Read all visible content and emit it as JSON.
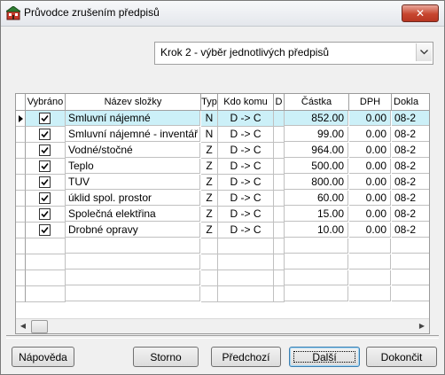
{
  "window": {
    "title": "Průvodce zrušením předpisů",
    "close_glyph": "✕"
  },
  "step_select": {
    "value": "Krok 2 - výběr jednotlivých předpisů"
  },
  "grid": {
    "columns": [
      "Vybráno",
      "Název složky",
      "Typ",
      "Kdo komu",
      "D",
      "Částka",
      "DPH",
      "Dokla"
    ],
    "rows": [
      {
        "checked": true,
        "name": "Smluvní nájemné",
        "typ": "N",
        "kdo_komu": "D -> C",
        "d": "",
        "castka": "852.00",
        "dph": "0.00",
        "doklad": "08-2",
        "selected": true
      },
      {
        "checked": true,
        "name": "Smluvní nájemné - inventář",
        "typ": "N",
        "kdo_komu": "D -> C",
        "d": "",
        "castka": "99.00",
        "dph": "0.00",
        "doklad": "08-2",
        "selected": false
      },
      {
        "checked": true,
        "name": "Vodné/stočné",
        "typ": "Z",
        "kdo_komu": "D -> C",
        "d": "",
        "castka": "964.00",
        "dph": "0.00",
        "doklad": "08-2",
        "selected": false
      },
      {
        "checked": true,
        "name": "Teplo",
        "typ": "Z",
        "kdo_komu": "D -> C",
        "d": "",
        "castka": "500.00",
        "dph": "0.00",
        "doklad": "08-2",
        "selected": false
      },
      {
        "checked": true,
        "name": "TUV",
        "typ": "Z",
        "kdo_komu": "D -> C",
        "d": "",
        "castka": "800.00",
        "dph": "0.00",
        "doklad": "08-2",
        "selected": false
      },
      {
        "checked": true,
        "name": "úklid spol. prostor",
        "typ": "Z",
        "kdo_komu": "D -> C",
        "d": "",
        "castka": "60.00",
        "dph": "0.00",
        "doklad": "08-2",
        "selected": false
      },
      {
        "checked": true,
        "name": "Společná elektřina",
        "typ": "Z",
        "kdo_komu": "D -> C",
        "d": "",
        "castka": "15.00",
        "dph": "0.00",
        "doklad": "08-2",
        "selected": false
      },
      {
        "checked": true,
        "name": "Drobné opravy",
        "typ": "Z",
        "kdo_komu": "D -> C",
        "d": "",
        "castka": "10.00",
        "dph": "0.00",
        "doklad": "08-2",
        "selected": false
      }
    ],
    "empty_rows": 4
  },
  "buttons": {
    "help": "Nápověda",
    "cancel": "Storno",
    "previous": "Předchozí",
    "next": "Další",
    "finish": "Dokončit"
  },
  "colors": {
    "selected_row": "#ccf0f8",
    "close_button": "#c7462f"
  },
  "icons": [
    "app-icon",
    "close-icon",
    "chevron-down-icon",
    "row-indicator-icon",
    "checkbox-check-icon",
    "scroll-left-icon",
    "scroll-right-icon"
  ]
}
